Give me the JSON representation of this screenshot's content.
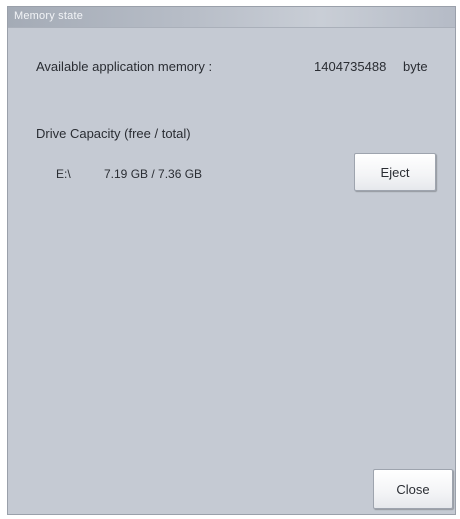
{
  "window": {
    "title": "Memory state"
  },
  "memory": {
    "label": "Available application memory :",
    "value": "1404735488",
    "unit": "byte"
  },
  "drive": {
    "heading": "Drive Capacity (free / total)",
    "name": "E:\\",
    "capacity": "7.19 GB / 7.36 GB",
    "eject_label": "Eject"
  },
  "footer": {
    "close_label": "Close"
  }
}
